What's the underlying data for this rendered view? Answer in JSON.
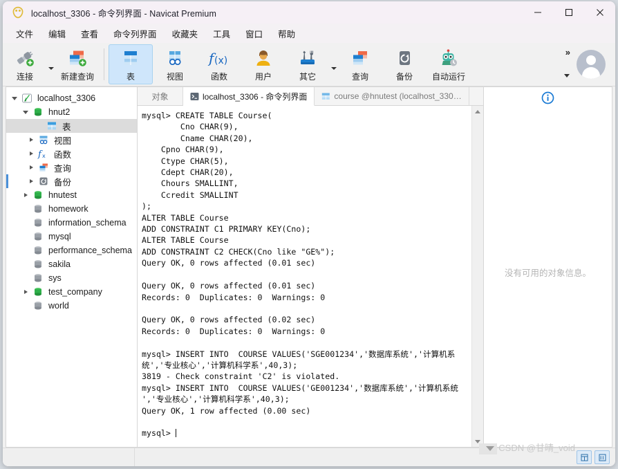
{
  "window": {
    "title": "localhost_3306 - 命令列界面 - Navicat Premium",
    "logo_icon": "navicat-logo-icon",
    "controls": [
      {
        "name": "minimize",
        "icon": "minimize-icon"
      },
      {
        "name": "maximize",
        "icon": "maximize-icon"
      },
      {
        "name": "close",
        "icon": "close-icon"
      }
    ]
  },
  "menubar": {
    "items": [
      {
        "label": "文件"
      },
      {
        "label": "编辑"
      },
      {
        "label": "查看"
      },
      {
        "label": "命令列界面"
      },
      {
        "label": "收藏夹"
      },
      {
        "label": "工具"
      },
      {
        "label": "窗口"
      },
      {
        "label": "帮助"
      }
    ]
  },
  "toolbar": {
    "left_group": [
      {
        "label": "连接",
        "icon": "connection-plug-icon",
        "has_caret": true,
        "active": false
      },
      {
        "label": "新建查询",
        "icon": "new-query-icon",
        "has_caret": false,
        "active": false
      }
    ],
    "right_group": [
      {
        "label": "表",
        "icon": "table-icon",
        "has_caret": false,
        "active": true
      },
      {
        "label": "视图",
        "icon": "view-icon",
        "has_caret": false,
        "active": false
      },
      {
        "label": "函数",
        "icon": "function-fx-icon",
        "has_caret": false,
        "active": false
      },
      {
        "label": "用户",
        "icon": "user-icon",
        "has_caret": false,
        "active": false
      },
      {
        "label": "其它",
        "icon": "other-tools-icon",
        "has_caret": true,
        "active": false
      },
      {
        "label": "查询",
        "icon": "query-icon",
        "has_caret": false,
        "active": false
      },
      {
        "label": "备份",
        "icon": "backup-icon",
        "has_caret": false,
        "active": false
      },
      {
        "label": "自动运行",
        "icon": "automation-robot-icon",
        "has_caret": false,
        "active": false
      }
    ],
    "overflow_icon": "chevron-double-right-icon",
    "overflow_caret_icon": "chevron-down-icon",
    "avatar_icon": "user-avatar-icon"
  },
  "sidebar": {
    "items": [
      {
        "label": "localhost_3306",
        "indent": 0,
        "twisty": "open",
        "icon": "navicat-connection-icon",
        "selected": false,
        "accent": false
      },
      {
        "label": "hnut2",
        "indent": 1,
        "twisty": "open",
        "icon": "database-green-icon",
        "selected": false,
        "accent": false
      },
      {
        "label": "表",
        "indent": 3,
        "twisty": "none",
        "icon": "table-icon",
        "selected": true,
        "accent": false
      },
      {
        "label": "视图",
        "indent": 2,
        "twisty": "closed",
        "icon": "view-icon",
        "selected": false,
        "accent": false
      },
      {
        "label": "函数",
        "indent": 2,
        "twisty": "closed",
        "icon": "function-fx-icon",
        "selected": false,
        "accent": false
      },
      {
        "label": "查询",
        "indent": 2,
        "twisty": "closed",
        "icon": "query-icon",
        "selected": false,
        "accent": false
      },
      {
        "label": "备份",
        "indent": 2,
        "twisty": "closed",
        "icon": "backup-icon",
        "selected": false,
        "accent": true
      },
      {
        "label": "hnutest",
        "indent": 1,
        "twisty": "closed",
        "icon": "database-green-icon",
        "selected": false,
        "accent": false
      },
      {
        "label": "homework",
        "indent": 1,
        "twisty": "none",
        "icon": "database-gray-icon",
        "selected": false,
        "accent": false
      },
      {
        "label": "information_schema",
        "indent": 1,
        "twisty": "none",
        "icon": "database-gray-icon",
        "selected": false,
        "accent": false
      },
      {
        "label": "mysql",
        "indent": 1,
        "twisty": "none",
        "icon": "database-gray-icon",
        "selected": false,
        "accent": false
      },
      {
        "label": "performance_schema",
        "indent": 1,
        "twisty": "none",
        "icon": "database-gray-icon",
        "selected": false,
        "accent": false
      },
      {
        "label": "sakila",
        "indent": 1,
        "twisty": "none",
        "icon": "database-gray-icon",
        "selected": false,
        "accent": false
      },
      {
        "label": "sys",
        "indent": 1,
        "twisty": "none",
        "icon": "database-gray-icon",
        "selected": false,
        "accent": false
      },
      {
        "label": "test_company",
        "indent": 1,
        "twisty": "closed",
        "icon": "database-green-icon",
        "selected": false,
        "accent": false
      },
      {
        "label": "world",
        "indent": 1,
        "twisty": "none",
        "icon": "database-gray-icon",
        "selected": false,
        "accent": false
      }
    ]
  },
  "main": {
    "tabs": [
      {
        "label": "对象",
        "icon": "none",
        "active": false
      },
      {
        "label": "localhost_3306 - 命令列界面",
        "icon": "terminal-icon",
        "active": true
      },
      {
        "label": "course @hnutest (localhost_330…",
        "icon": "table-icon",
        "active": false
      }
    ],
    "console_text": "mysql> CREATE TABLE Course(\n        Cno CHAR(9),\n        Cname CHAR(20),\n    Cpno CHAR(9),\n    Ctype CHAR(5),\n    Cdept CHAR(20),\n    Chours SMALLINT,\n    Ccredit SMALLINT\n);\nALTER TABLE Course\nADD CONSTRAINT C1 PRIMARY KEY(Cno);\nALTER TABLE Course\nADD CONSTRAINT C2 CHECK(Cno like \"GE%\");\nQuery OK, 0 rows affected (0.01 sec)\n\nQuery OK, 0 rows affected (0.01 sec)\nRecords: 0  Duplicates: 0  Warnings: 0\n\nQuery OK, 0 rows affected (0.02 sec)\nRecords: 0  Duplicates: 0  Warnings: 0\n\nmysql> INSERT INTO  COURSE VALUES('SGE001234','数据库系统','计算机系\n统','专业核心','计算机科学系',40,3);\n3819 - Check constraint 'C2' is violated.\nmysql> INSERT INTO  COURSE VALUES('GE001234','数据库系统','计算机系统\n','专业核心','计算机科学系',40,3);\nQuery OK, 1 row affected (0.00 sec)\n\nmysql> ",
    "scrollbar": {
      "up_icon": "arrow-up-icon",
      "down_icon": "arrow-down-icon"
    }
  },
  "info_panel": {
    "icon": "info-circle-icon",
    "empty_text": "没有可用的对象信息。"
  },
  "statusbar": {
    "buttons": [
      {
        "name": "grid-view-button",
        "icon": "grid-view-icon"
      },
      {
        "name": "form-view-button",
        "icon": "form-view-icon"
      }
    ]
  },
  "watermark": "CSDN @甘晴_void",
  "colors": {
    "accent_blue": "#0b6fc4",
    "selection_gray": "#dcdcdc",
    "tab_active_bg": "#ffffff",
    "toolbar_bg": "#f1f1f1",
    "titlebar_bg": "#f6f0f6",
    "active_tool_bg": "#cfe6fb"
  }
}
